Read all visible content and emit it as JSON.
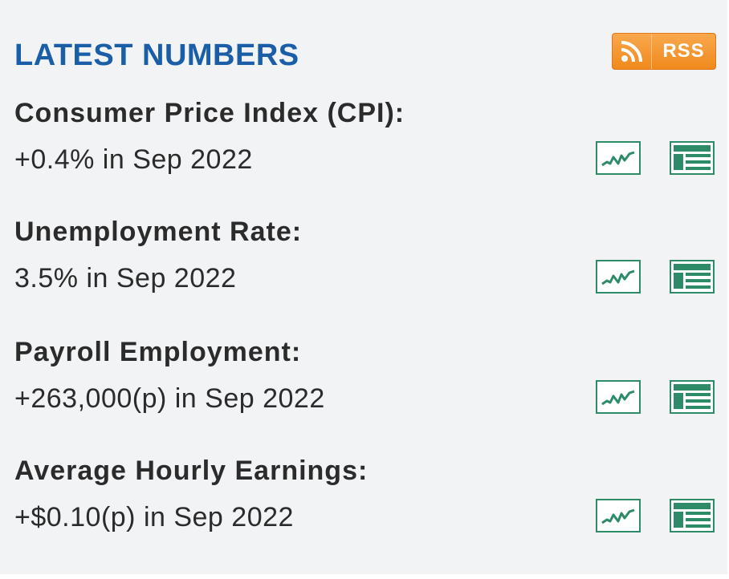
{
  "header": {
    "title": "LATEST NUMBERS",
    "rss_label": "RSS"
  },
  "stats": [
    {
      "label": "Consumer Price Index (CPI):",
      "value": "+0.4% in Sep 2022"
    },
    {
      "label": "Unemployment Rate:",
      "value": "3.5% in Sep 2022"
    },
    {
      "label": "Payroll Employment:",
      "value": "+263,000(p) in Sep 2022"
    },
    {
      "label": "Average Hourly Earnings:",
      "value": "+$0.10(p) in Sep 2022"
    }
  ],
  "icons": {
    "chart": "line-chart-icon",
    "table": "data-table-icon",
    "rss": "rss-feed-icon"
  },
  "colors": {
    "title": "#1a5ea8",
    "text": "#2b2b2b",
    "icon_green": "#2e8b67",
    "rss_orange": "#f08a1c",
    "panel_bg": "#f2f3f5"
  }
}
